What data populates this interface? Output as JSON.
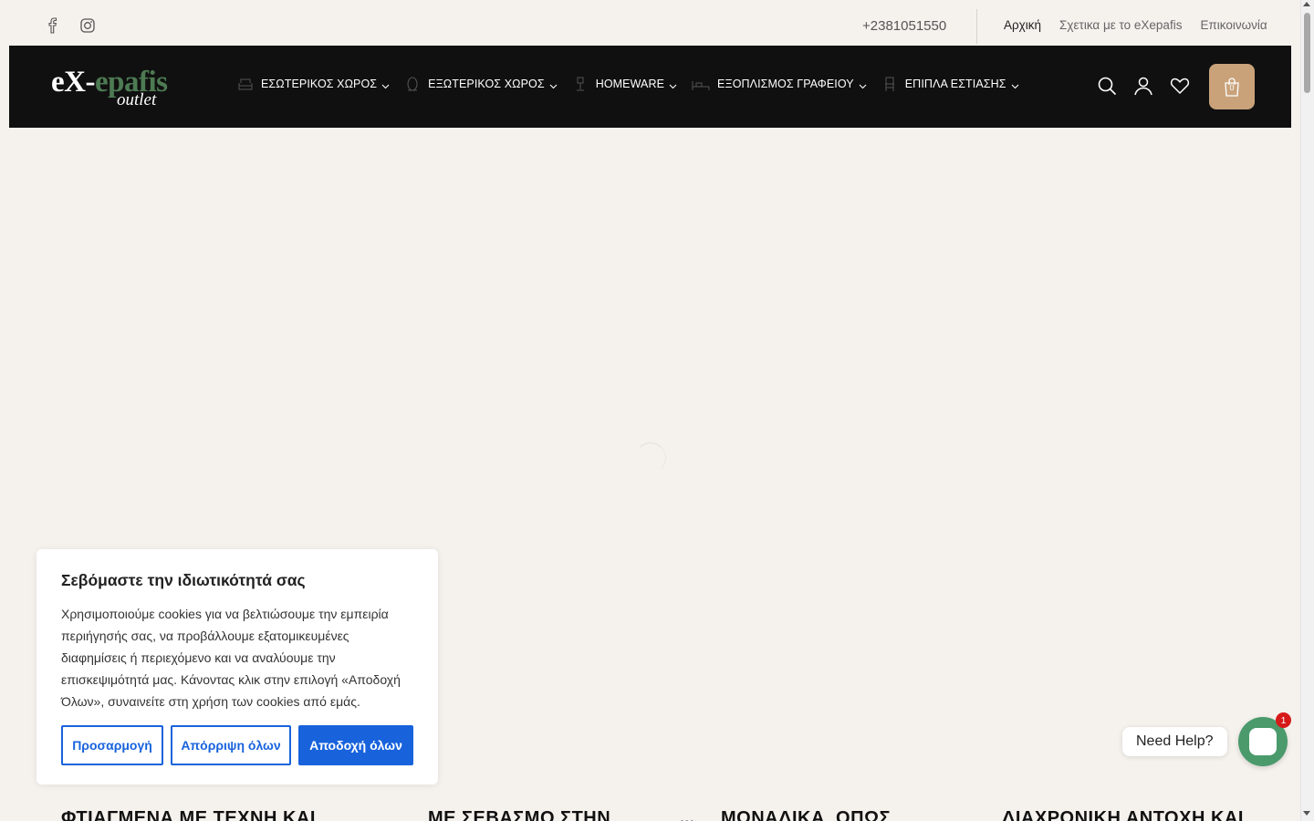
{
  "topbar": {
    "social": [
      {
        "icon": "facebook-icon"
      },
      {
        "icon": "instagram-icon"
      }
    ],
    "phone": "+2381051550",
    "links": [
      {
        "label": "Αρχική",
        "active": true
      },
      {
        "label": "Σχετικα με το eXepafis",
        "active": false
      },
      {
        "label": "Επικοινωνία",
        "active": false
      }
    ]
  },
  "header": {
    "logo": {
      "part1": "eX-",
      "part2": "epafis",
      "part3": "outlet",
      "accent": "#4d7a52"
    },
    "nav": [
      {
        "label": "ΕΣΩΤΕΡΙΚΟΣ ΧΩΡΟΣ",
        "icon": "sofa-icon"
      },
      {
        "label": "ΕΞΩΤΕΡΙΚΟΣ ΧΩΡΟΣ",
        "icon": "garden-chair-icon"
      },
      {
        "label": "HOMEWARE",
        "icon": "lamp-icon"
      },
      {
        "label": "ΕΞΟΠΛΙΣΜΟΣ ΓΡΑΦΕΙΟΥ",
        "icon": "desk-icon"
      },
      {
        "label": "ΕΠΙΠΛΑ ΕΣΤΙΑΣΗΣ",
        "icon": "chair-icon"
      }
    ],
    "icons": [
      "search-icon",
      "account-icon",
      "wishlist-icon"
    ],
    "cart_count": "0",
    "cart_color": "#c9a27a"
  },
  "cookie": {
    "title": "Σεβόμαστε την ιδιωτικότητά σας",
    "text": "Χρησιμοποιούμε cookies για να βελτιώσουμε την εμπειρία περιήγησής σας, να προβάλλουμε εξατομικευμένες διαφημίσεις ή περιεχόμενο και να αναλύουμε την επισκεψιμότητά μας. Κάνοντας κλικ στην επιλογή «Αποδοχή Όλων», συναινείτε στη χρήση των cookies από εμάς.",
    "customize_label": "Προσαρμογή",
    "reject_label": "Απόρριψη όλων",
    "accept_label": "Αποδοχή όλων",
    "accent": "#1863dc"
  },
  "chat": {
    "label": "Need Help?",
    "badge": "1"
  },
  "features": [
    "ΦΤΙΑΓΜΕΝΑ ΜΕ ΤΕΧΝΗ ΚΑΙ",
    "ΜΕ ΣΕΒΑΣΜΟ ΣΤΗΝ",
    "ΜΟΝΑΔΙΚΑ, ΟΠΩΣ",
    "ΔΙΑΧΡΟΝΙΚΗ ΑΝΤΟΧΗ ΚΑΙ"
  ]
}
